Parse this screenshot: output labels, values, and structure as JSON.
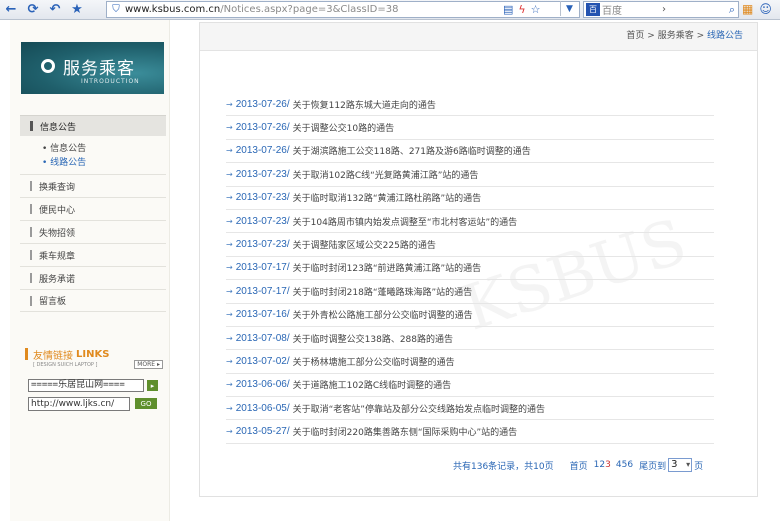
{
  "browser": {
    "url_host": "www.ksbus.com.cn",
    "url_path": "/Notices.aspx?page=3&ClassID=38",
    "search_placeholder": "百度"
  },
  "banner": {
    "title": "服务乘客",
    "subtitle": "INTRODUCTION"
  },
  "nav": {
    "active": "信息公告",
    "subitems": [
      "信息公告",
      "线路公告"
    ],
    "items": [
      "换乘查询",
      "便民中心",
      "失物招领",
      "乘车规章",
      "服务承诺",
      "留言板"
    ]
  },
  "links": {
    "title_cn": "友情链接",
    "title_en": "LINKS",
    "subtitle": "[ DESIGN SUICH LAPTOP ]",
    "more": "MORE",
    "select_value": "=====乐居昆山网====",
    "url_value": "http://www.ljks.cn/",
    "go": "GO"
  },
  "breadcrumb": {
    "home": "首页",
    "sep1": " > ",
    "section": "服务乘客",
    "sep2": " > ",
    "current": "线路公告"
  },
  "notices": [
    {
      "date": "2013-07-26/",
      "title": "关于恢复112路东城大道走向的通告"
    },
    {
      "date": "2013-07-26/",
      "title": "关于调整公交10路的通告"
    },
    {
      "date": "2013-07-26/",
      "title": "关于湖滨路施工公交118路、271路及游6路临时调整的通告"
    },
    {
      "date": "2013-07-23/",
      "title": "关于取消102路C线“光复路黄浦江路”站的通告"
    },
    {
      "date": "2013-07-23/",
      "title": "关于临时取消132路“黄浦江路杜鹃路”站的通告"
    },
    {
      "date": "2013-07-23/",
      "title": "关于104路周市镇内始发点调整至“市北村客运站”的通告"
    },
    {
      "date": "2013-07-23/",
      "title": "关于调整陆家区域公交225路的通告"
    },
    {
      "date": "2013-07-17/",
      "title": "关于临时封闭123路“前进路黄浦江路”站的通告"
    },
    {
      "date": "2013-07-17/",
      "title": "关于临时封闭218路“蓬曦路珠海路”站的通告"
    },
    {
      "date": "2013-07-16/",
      "title": "关于外青松公路施工部分公交临时调整的通告"
    },
    {
      "date": "2013-07-08/",
      "title": "关于临时调整公交138路、288路的通告"
    },
    {
      "date": "2013-07-02/",
      "title": "关于杨林塘施工部分公交临时调整的通告"
    },
    {
      "date": "2013-06-06/",
      "title": "关于道路施工102路C线临时调整的通告"
    },
    {
      "date": "2013-06-05/",
      "title": "关于取消“老客站”停靠站及部分公交线路始发点临时调整的通告"
    },
    {
      "date": "2013-05-27/",
      "title": "关于临时封闭220路集善路东侧“国际采购中心”站的通告"
    }
  ],
  "pager": {
    "summary": "共有136条记录，共10页",
    "first": "首页",
    "p1": "1",
    "p2": "2",
    "p3": "3",
    "p4": "4",
    "p5": "5",
    "p6": "6",
    "last": "尾页到",
    "current_page": "3",
    "page_suffix": "页"
  },
  "watermark": "KSBUS",
  "colors": {
    "link": "#2a67b5",
    "accent": "#e08a1e",
    "banner": "#1f5f6b",
    "go": "#5f8f2c"
  }
}
